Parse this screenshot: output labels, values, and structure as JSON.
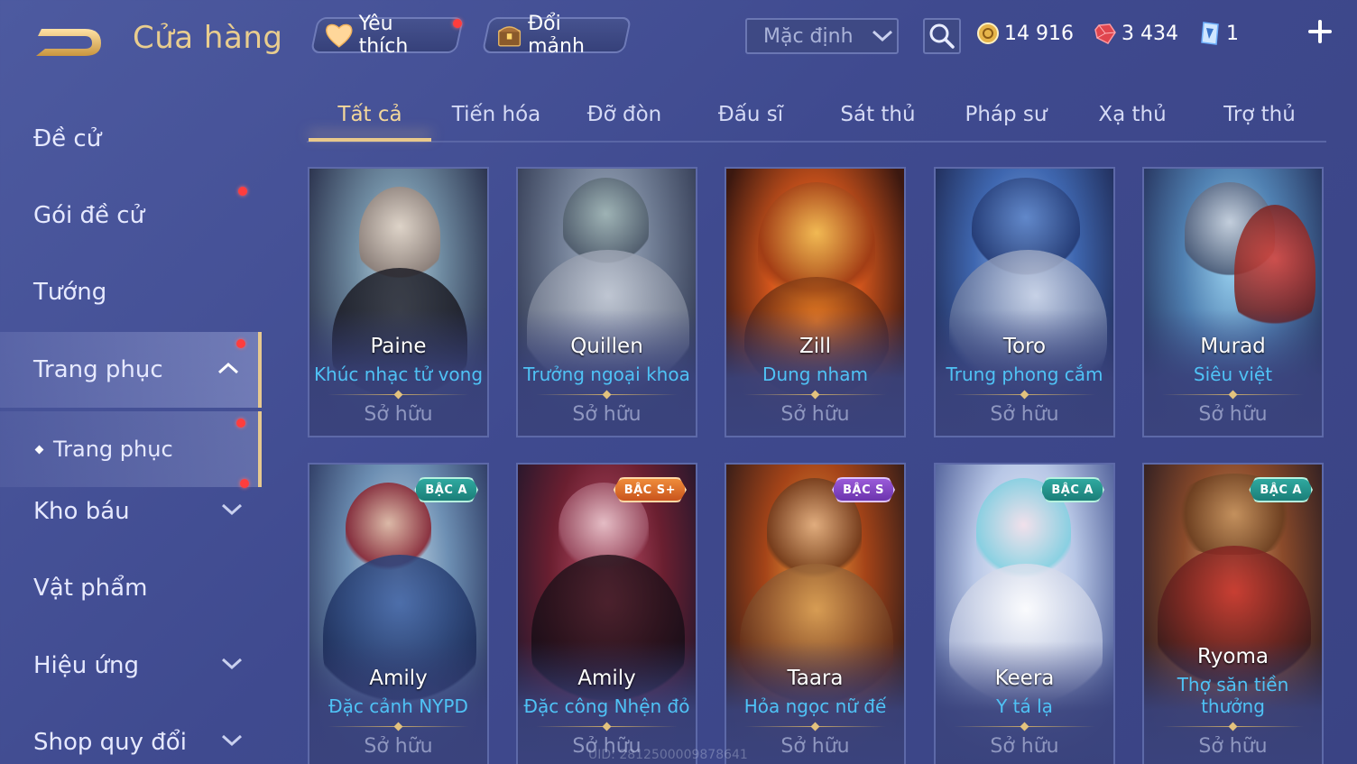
{
  "header": {
    "title": "Cửa hàng",
    "favorites_label": "Yêu thích",
    "exchange_label": "Đổi mảnh",
    "sort_value": "Mặc định"
  },
  "currencies": [
    {
      "name": "gold",
      "icon": "gold-coin-icon",
      "value": "14 916"
    },
    {
      "name": "ruby",
      "icon": "ruby-gem-icon",
      "value": "3 434"
    },
    {
      "name": "voucher",
      "icon": "voucher-ticket-icon",
      "value": "1"
    }
  ],
  "sidebar": {
    "items": [
      {
        "label": "Đề cử"
      },
      {
        "label": "Gói đề cử"
      },
      {
        "label": "Tướng"
      },
      {
        "label": "Trang phục"
      },
      {
        "label": "Trang phục"
      },
      {
        "label": "Kho báu"
      },
      {
        "label": "Vật phẩm"
      },
      {
        "label": "Hiệu ứng"
      },
      {
        "label": "Shop quy đổi"
      }
    ]
  },
  "tabs": [
    "Tất cả",
    "Tiến hóa",
    "Đỡ đòn",
    "Đấu sĩ",
    "Sát thủ",
    "Pháp sư",
    "Xạ thủ",
    "Trợ thủ"
  ],
  "active_tab": "Tất cả",
  "cards": [
    {
      "hero": "Paine",
      "skin": "Khúc nhạc tử vong",
      "status": "Sở hữu"
    },
    {
      "hero": "Quillen",
      "skin": "Trưởng ngoại khoa",
      "status": "Sở hữu"
    },
    {
      "hero": "Zill",
      "skin": "Dung nham",
      "status": "Sở hữu"
    },
    {
      "hero": "Toro",
      "skin": "Trung phong cắm",
      "status": "Sở hữu"
    },
    {
      "hero": "Murad",
      "skin": "Siêu việt",
      "status": "Sở hữu"
    },
    {
      "hero": "Amily",
      "skin": "Đặc cảnh NYPD",
      "status": "Sở hữu",
      "badge": "BẬC A"
    },
    {
      "hero": "Amily",
      "skin": "Đặc công Nhện đỏ",
      "status": "Sở hữu",
      "badge": "BẬC S+"
    },
    {
      "hero": "Taara",
      "skin": "Hỏa ngọc nữ đế",
      "status": "Sở hữu",
      "badge": "BẬC S"
    },
    {
      "hero": "Keera",
      "skin": "Y tá lạ",
      "status": "Sở hữu",
      "badge": "BẬC A"
    },
    {
      "hero": "Ryoma",
      "skin": "Thợ săn tiền thưởng",
      "status": "Sở hữu",
      "badge": "BẬC A"
    }
  ],
  "footer": {
    "uid": "UID: 2812500009878641"
  },
  "colors": {
    "accent_gold": "#e9cd8e",
    "skin_name_blue": "#4fc2f5",
    "notification_red": "#ff3d3d",
    "background": "#4d5aa0"
  }
}
